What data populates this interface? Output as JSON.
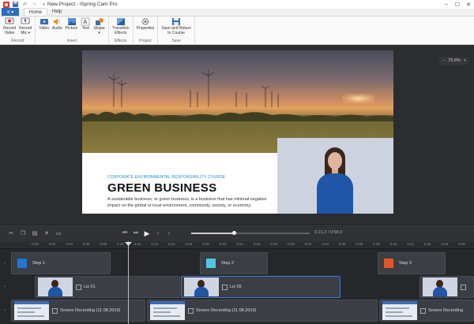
{
  "window": {
    "title": "New Project - iSpring Cam Pro",
    "controls": [
      "–",
      "☐",
      "✕"
    ]
  },
  "ribbon": {
    "file_label": "≡ ▾",
    "tabs": [
      "Home",
      "Help"
    ],
    "active_tab": "Home",
    "groups": [
      {
        "label": "Record",
        "buttons": [
          {
            "label": "Record\nVideo",
            "icon": "record-video-icon"
          },
          {
            "label": "Record\nMic ▾",
            "icon": "record-mic-icon"
          }
        ]
      },
      {
        "label": "Insert",
        "buttons": [
          {
            "label": "Video",
            "icon": "video-icon"
          },
          {
            "label": "Audio",
            "icon": "audio-icon"
          },
          {
            "label": "Picture",
            "icon": "picture-icon"
          },
          {
            "label": "Text",
            "icon": "text-icon"
          },
          {
            "label": "Shape\n▾",
            "icon": "shape-icon"
          }
        ]
      },
      {
        "label": "Effects",
        "buttons": [
          {
            "label": "Transition\nEffects",
            "icon": "transition-icon"
          }
        ]
      },
      {
        "label": "Project",
        "buttons": [
          {
            "label": "Properties",
            "icon": "gear-icon"
          }
        ]
      },
      {
        "label": "Save",
        "buttons": [
          {
            "label": "Save and Return\nto Course",
            "icon": "save-icon"
          }
        ]
      }
    ]
  },
  "stage": {
    "zoom_out": "−",
    "zoom_level": "75.6%",
    "zoom_in": "+"
  },
  "slide": {
    "kicker": "CORPORATE ENVIRONMENTAL RESPONSIBILITY COURSE",
    "headline": "GREEN BUSINESS",
    "description": "A sustainable business, or green business, is a business that has minimal negative impact on the global or local environment, community, society, or economy."
  },
  "transport": {
    "time": "0:21.2 / 0:58.0",
    "progress": 0.366
  },
  "timeline": {
    "ruler_ticks": [
      "0:00",
      "0:02",
      "0:04",
      "0:06",
      "0:08",
      "0:10",
      "0:12",
      "0:14",
      "0:16",
      "0:18",
      "0:20",
      "0:22",
      "0:24",
      "0:26",
      "0:28",
      "0:30",
      "0:32",
      "0:34",
      "0:36",
      "0:38",
      "0:40",
      "0:42",
      "0:44",
      "0:46",
      "0:48",
      "0:50",
      "0:52",
      "0:54",
      "0:56"
    ],
    "steps": [
      {
        "label": "Step 1",
        "color": "#2277d6"
      },
      {
        "label": "Step 2",
        "color": "#4fc8e6"
      },
      {
        "label": "Step 3",
        "color": "#e2572a"
      }
    ],
    "video_clips": [
      {
        "label": "Liz 01"
      },
      {
        "label": "Liz 05"
      },
      {
        "label": ""
      }
    ],
    "recordings": [
      {
        "label": "Screen Recording (11.08.2019)"
      },
      {
        "label": "Screen Recording (11.08.2019)"
      },
      {
        "label": "Screen Recording"
      }
    ]
  },
  "colors": {
    "accent": "#2a6ebb",
    "stage_bg": "#2b2d31",
    "selection": "#3b7dd8"
  }
}
